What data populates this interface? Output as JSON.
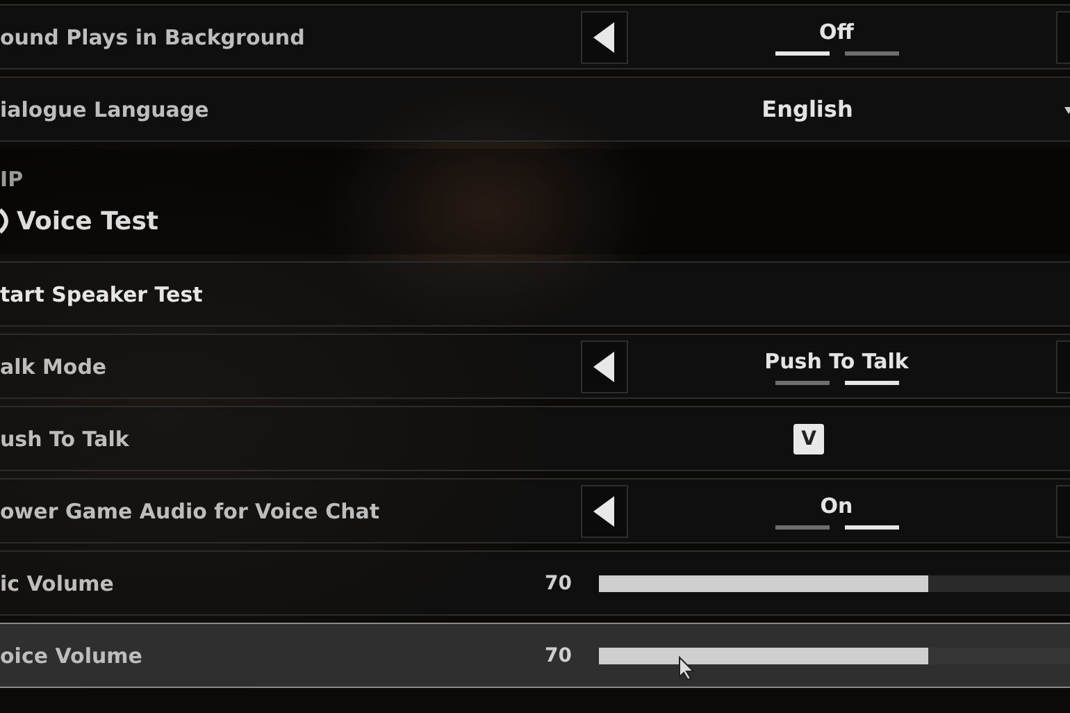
{
  "rows": [
    {
      "kind": "selector",
      "label": "ound Plays in Background",
      "value": "Off",
      "selected": false,
      "segments": [
        {
          "selected": true
        },
        {
          "selected": false
        }
      ]
    },
    {
      "kind": "dropdown",
      "label": "ialogue Language",
      "value": "English",
      "selected": false
    },
    {
      "kind": "section",
      "title": "IP",
      "heading": "Voice Test",
      "selected": false
    },
    {
      "kind": "button",
      "label": "tart Speaker Test",
      "selected": false
    },
    {
      "kind": "selector",
      "label": "alk Mode",
      "value": "Push To Talk",
      "selected": false,
      "segments": [
        {
          "selected": false
        },
        {
          "selected": true
        }
      ]
    },
    {
      "kind": "keybind",
      "label": "ush To Talk",
      "key": "V",
      "selected": false
    },
    {
      "kind": "selector",
      "label": "ower Game Audio for Voice Chat",
      "value": "On",
      "selected": false,
      "segments": [
        {
          "selected": false
        },
        {
          "selected": true
        }
      ]
    },
    {
      "kind": "slider",
      "label": "ic Volume",
      "reading": "70",
      "level": 0.7,
      "selected": false
    },
    {
      "kind": "slider",
      "label": "oice Volume",
      "reading": "70",
      "level": 0.7,
      "selected": true
    }
  ]
}
